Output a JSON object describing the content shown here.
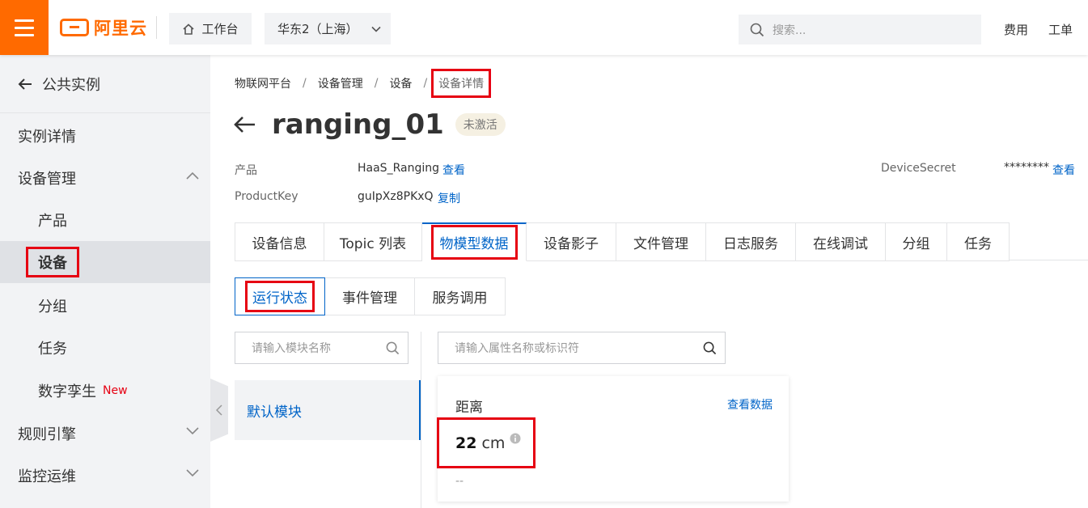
{
  "topbar": {
    "logo_text": "阿里云",
    "workbench": "工作台",
    "region": "华东2（上海）",
    "search_placeholder": "搜索...",
    "links": [
      "费用",
      "工单"
    ],
    "brand_color": "#ff6a00"
  },
  "sidebar": {
    "back_label": "公共实例",
    "items": [
      {
        "label": "实例详情"
      },
      {
        "label": "设备管理"
      },
      {
        "label": "产品"
      },
      {
        "label": "设备"
      },
      {
        "label": "分组"
      },
      {
        "label": "任务"
      },
      {
        "label": "数字孪生",
        "tag": "New"
      },
      {
        "label": "规则引擎"
      },
      {
        "label": "监控运维"
      }
    ]
  },
  "breadcrumb": [
    "物联网平台",
    "设备管理",
    "设备",
    "设备详情"
  ],
  "device": {
    "name": "ranging_01",
    "status": "未激活",
    "product_label": "产品",
    "product_value": "HaaS_Ranging",
    "product_link": "查看",
    "productkey_label": "ProductKey",
    "productkey_value": "guIpXz8PKxQ",
    "productkey_link": "复制",
    "secret_label": "DeviceSecret",
    "secret_value": "********",
    "secret_link": "查看"
  },
  "tabs": [
    "设备信息",
    "Topic 列表",
    "物模型数据",
    "设备影子",
    "文件管理",
    "日志服务",
    "在线调试",
    "分组",
    "任务"
  ],
  "subtabs": [
    "运行状态",
    "事件管理",
    "服务调用"
  ],
  "module_search_placeholder": "请输入模块名称",
  "property_search_placeholder": "请输入属性名称或标识符",
  "module": "默认模块",
  "property": {
    "name": "距离",
    "link": "查看数据",
    "value": "22",
    "unit": "cm",
    "time": "--"
  },
  "accent_color": "#0064c8",
  "highlight_color": "#e60012"
}
